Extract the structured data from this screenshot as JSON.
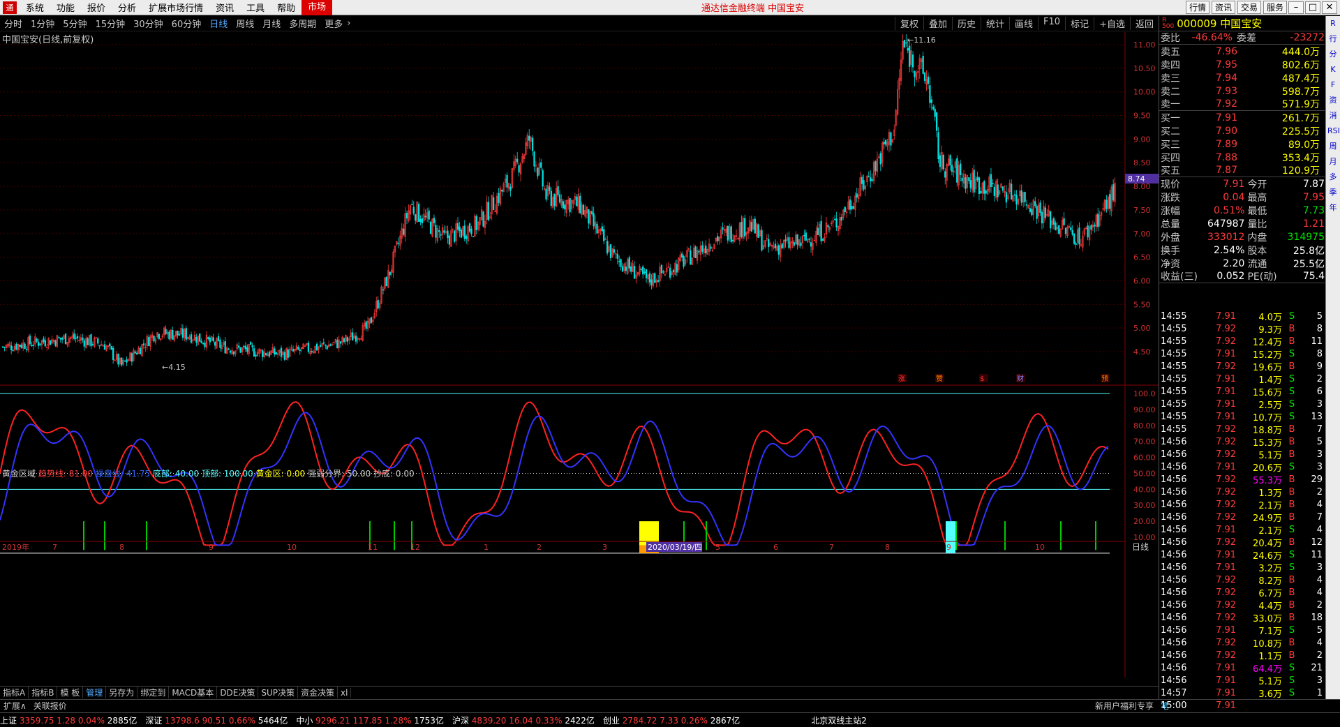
{
  "menubar": {
    "items": [
      "系统",
      "功能",
      "报价",
      "分析",
      "扩展市场行情",
      "资讯",
      "工具",
      "帮助",
      "市场"
    ],
    "app_title": "通达信金融终端  中国宝安",
    "right_buttons": [
      "行情",
      "资讯",
      "交易",
      "服务"
    ]
  },
  "periods": [
    "分时",
    "1分钟",
    "5分钟",
    "15分钟",
    "30分钟",
    "60分钟",
    "日线",
    "周线",
    "月线",
    "多周期",
    "更多"
  ],
  "active_period": "日线",
  "toolbar_right": [
    "复权",
    "叠加",
    "历史",
    "统计",
    "画线",
    "F10",
    "标记",
    "+自选",
    "返回"
  ],
  "chart_title": "中国宝安(日线,前复权)",
  "indicator": {
    "name": "黄金区域",
    "items": [
      {
        "t": "趋势线: 81.00",
        "c": "#ff3b3b"
      },
      {
        "t": "操盘线: 41.75",
        "c": "#3366ff"
      },
      {
        "t": "底部: 40.00",
        "c": "#5ff"
      },
      {
        "t": "顶部: 100.00",
        "c": "#5ff"
      },
      {
        "t": "黄金区: 0.00",
        "c": "#ff0"
      },
      {
        "t": "强弱分界: 50.00",
        "c": "#c8c8c8"
      },
      {
        "t": "抄底: 0.00",
        "c": "#c8c8c8"
      }
    ]
  },
  "chart_data": {
    "type": "candlestick",
    "price_ticks": [
      "11.00",
      "10.50",
      "10.00",
      "9.50",
      "9.00",
      "8.50",
      "8.00",
      "7.50",
      "7.00",
      "6.50",
      "6.00",
      "5.50",
      "5.00",
      "4.50"
    ],
    "ind_ticks": [
      "100.0",
      "90.00",
      "80.00",
      "70.00",
      "60.00",
      "50.00",
      "40.00",
      "30.00",
      "20.00",
      "10.00"
    ],
    "high_label": "11.16",
    "low_label": "4.15",
    "cursor_price": "8.74",
    "cursor_date": "2020/03/19/四",
    "x_labels": [
      "2019年",
      "7",
      "8",
      "9",
      "10",
      "11",
      "12",
      "1",
      "2",
      "3",
      "4",
      "5",
      "6",
      "7",
      "8",
      "9",
      "10"
    ],
    "markers": [
      "涨",
      "赞",
      "$",
      "财",
      "预"
    ],
    "period_label": "日线"
  },
  "tabs": [
    "指标A",
    "指标B",
    "模 板",
    "管理",
    "另存为",
    "绑定到",
    "MACD基本",
    "DDE决策",
    "SUP决策",
    "资金决策",
    "xl"
  ],
  "tabs_active": "管理",
  "tabs2": [
    "扩展∧",
    "关联报价"
  ],
  "tabs2_right": "新用户福利专享",
  "tabs2_right2": "笔",
  "status": [
    {
      "n": "上证",
      "v": "3359.75",
      "c": "1.28",
      "p": "0.04%",
      "a": "2885亿"
    },
    {
      "n": "深证",
      "v": "13798.6",
      "c": "90.51",
      "p": "0.66%",
      "a": "5464亿"
    },
    {
      "n": "中小",
      "v": "9296.21",
      "c": "117.85",
      "p": "1.28%",
      "a": "1753亿"
    },
    {
      "n": "沪深",
      "v": "4839.20",
      "c": "16.04",
      "p": "0.33%",
      "a": "2422亿"
    },
    {
      "n": "创业",
      "v": "2784.72",
      "c": "7.33",
      "p": "0.26%",
      "a": "2867亿"
    }
  ],
  "status_server": "北京双线主站2",
  "quote": {
    "code": "000009",
    "name": "中国宝安",
    "wb": "-46.64%",
    "wc": "-23272",
    "sells": [
      [
        "卖五",
        "7.96",
        "444.0万"
      ],
      [
        "卖四",
        "7.95",
        "802.6万"
      ],
      [
        "卖三",
        "7.94",
        "487.4万"
      ],
      [
        "卖二",
        "7.93",
        "598.7万"
      ],
      [
        "卖一",
        "7.92",
        "571.9万"
      ]
    ],
    "buys": [
      [
        "买一",
        "7.91",
        "261.7万"
      ],
      [
        "买二",
        "7.90",
        "225.5万"
      ],
      [
        "买三",
        "7.89",
        "89.0万"
      ],
      [
        "买四",
        "7.88",
        "353.4万"
      ],
      [
        "买五",
        "7.87",
        "120.9万"
      ]
    ],
    "info": [
      [
        "现价",
        "7.91",
        "今开",
        "7.87"
      ],
      [
        "涨跌",
        "0.04",
        "最高",
        "7.95"
      ],
      [
        "涨幅",
        "0.51%",
        "最低",
        "7.73"
      ],
      [
        "总量",
        "647987",
        "量比",
        "1.21"
      ],
      [
        "外盘",
        "333012",
        "内盘",
        "314975"
      ],
      [
        "换手",
        "2.54%",
        "股本",
        "25.8亿"
      ],
      [
        "净资",
        "2.20",
        "流通",
        "25.5亿"
      ],
      [
        "收益(三)",
        "0.052",
        "PE(动)",
        "75.4"
      ]
    ]
  },
  "ticks": [
    [
      "14:55",
      "7.91",
      "4.0万",
      "S",
      "5"
    ],
    [
      "14:55",
      "7.92",
      "9.3万",
      "B",
      "8"
    ],
    [
      "14:55",
      "7.92",
      "12.4万",
      "B",
      "11"
    ],
    [
      "14:55",
      "7.91",
      "15.2万",
      "S",
      "8"
    ],
    [
      "14:55",
      "7.92",
      "19.6万",
      "B",
      "9"
    ],
    [
      "14:55",
      "7.91",
      "1.4万",
      "S",
      "2"
    ],
    [
      "14:55",
      "7.91",
      "15.6万",
      "S",
      "6"
    ],
    [
      "14:55",
      "7.91",
      "2.5万",
      "S",
      "3"
    ],
    [
      "14:55",
      "7.91",
      "10.7万",
      "S",
      "13"
    ],
    [
      "14:55",
      "7.92",
      "18.8万",
      "B",
      "7"
    ],
    [
      "14:56",
      "7.92",
      "15.3万",
      "B",
      "5"
    ],
    [
      "14:56",
      "7.92",
      "5.1万",
      "B",
      "3"
    ],
    [
      "14:56",
      "7.91",
      "20.6万",
      "S",
      "3"
    ],
    [
      "14:56",
      "7.92",
      "55.3万",
      "B",
      "29"
    ],
    [
      "14:56",
      "7.92",
      "1.3万",
      "B",
      "2"
    ],
    [
      "14:56",
      "7.92",
      "2.1万",
      "B",
      "4"
    ],
    [
      "14:56",
      "7.92",
      "24.9万",
      "B",
      "7"
    ],
    [
      "14:56",
      "7.91",
      "2.1万",
      "S",
      "4"
    ],
    [
      "14:56",
      "7.92",
      "20.4万",
      "B",
      "12"
    ],
    [
      "14:56",
      "7.91",
      "24.6万",
      "S",
      "11"
    ],
    [
      "14:56",
      "7.91",
      "3.2万",
      "S",
      "3"
    ],
    [
      "14:56",
      "7.92",
      "8.2万",
      "B",
      "4"
    ],
    [
      "14:56",
      "7.92",
      "6.7万",
      "B",
      "4"
    ],
    [
      "14:56",
      "7.92",
      "4.4万",
      "B",
      "2"
    ],
    [
      "14:56",
      "7.92",
      "33.0万",
      "B",
      "18"
    ],
    [
      "14:56",
      "7.91",
      "7.1万",
      "S",
      "5"
    ],
    [
      "14:56",
      "7.92",
      "10.8万",
      "B",
      "4"
    ],
    [
      "14:56",
      "7.92",
      "1.1万",
      "B",
      "2"
    ],
    [
      "14:56",
      "7.91",
      "64.4万",
      "S",
      "21"
    ],
    [
      "14:56",
      "7.91",
      "5.1万",
      "S",
      "3"
    ],
    [
      "14:57",
      "7.91",
      "3.6万",
      "S",
      "1"
    ],
    [
      "15:00",
      "7.91",
      "",
      "",
      ""
    ]
  ],
  "sidebar": [
    "R",
    "行",
    "分",
    "K",
    "F",
    "资",
    "消",
    "RSI",
    "周",
    "月",
    "多",
    "季",
    "年"
  ]
}
